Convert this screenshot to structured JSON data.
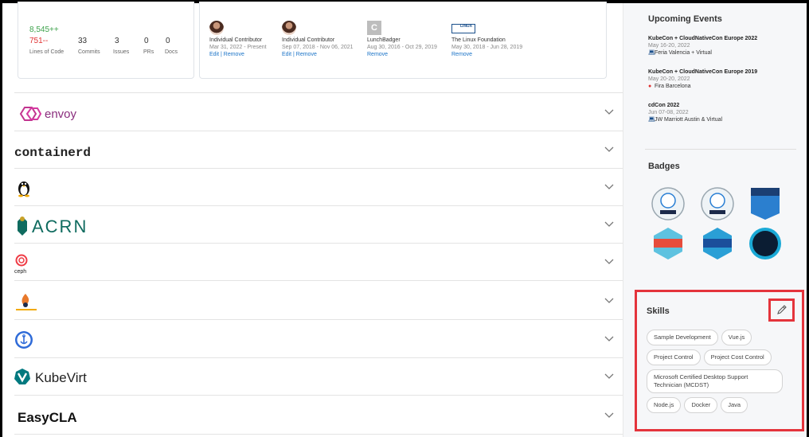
{
  "stats": {
    "loc_added": "8,545++",
    "loc_deleted": "751--",
    "loc_label": "Lines of Code",
    "items": [
      {
        "value": "33",
        "label": "Commits"
      },
      {
        "value": "3",
        "label": "Issues"
      },
      {
        "value": "0",
        "label": "PRs"
      },
      {
        "value": "0",
        "label": "Docs"
      }
    ]
  },
  "affiliations": [
    {
      "role": "Individual Contributor",
      "dates": "Mar 31, 2022 - Present",
      "edit": "Edit",
      "remove": "Remove"
    },
    {
      "role": "Individual Contributor",
      "dates": "Sep 07, 2018 - Nov 06, 2021",
      "edit": "Edit",
      "remove": "Remove"
    },
    {
      "role": "LunchBadger",
      "logo_letter": "C",
      "dates": "Aug 30, 2016 - Oct 29, 2019",
      "remove": "Remove"
    },
    {
      "role": "The Linux Foundation",
      "logo_text": "LINUX",
      "dates": "May 30, 2018 - Jun 28, 2019",
      "remove": "Remove"
    }
  ],
  "projects": [
    {
      "name": "envoy"
    },
    {
      "name": "containerd"
    },
    {
      "name": "tux"
    },
    {
      "name": "ACRN"
    },
    {
      "name": "ceph"
    },
    {
      "name": "fire"
    },
    {
      "name": "anchor"
    },
    {
      "name": "KubeVirt"
    },
    {
      "name": "EasyCLA"
    }
  ],
  "events": {
    "title": "Upcoming Events",
    "items": [
      {
        "name": "KubeCon + CloudNativeCon Europe 2022",
        "date": "May 16-20, 2022",
        "place": "Feria Valencia + Virtual",
        "icon": "laptop-icon"
      },
      {
        "name": "KubeCon + CloudNativeCon Europe 2019",
        "date": "May 20-20, 2022",
        "place": "Fira Barcelona",
        "icon": "pin-icon"
      },
      {
        "name": "cdCon 2022",
        "date": "Jun 07-08, 2022",
        "place": "JW Marriott Austin & Virtual",
        "icon": "laptop-icon"
      }
    ]
  },
  "badges": {
    "title": "Badges"
  },
  "skills": {
    "title": "Skills",
    "items": [
      "Sample Development",
      "Vue.js",
      "Project Control",
      "Project Cost Control",
      "Microsoft Certified Desktop Support Technician (MCDST)",
      "Node.js",
      "Docker",
      "Java"
    ]
  },
  "colors": {
    "added": "#3fa34d",
    "deleted": "#e03131",
    "link": "#1a73c7",
    "highlight": "#e4343c"
  }
}
